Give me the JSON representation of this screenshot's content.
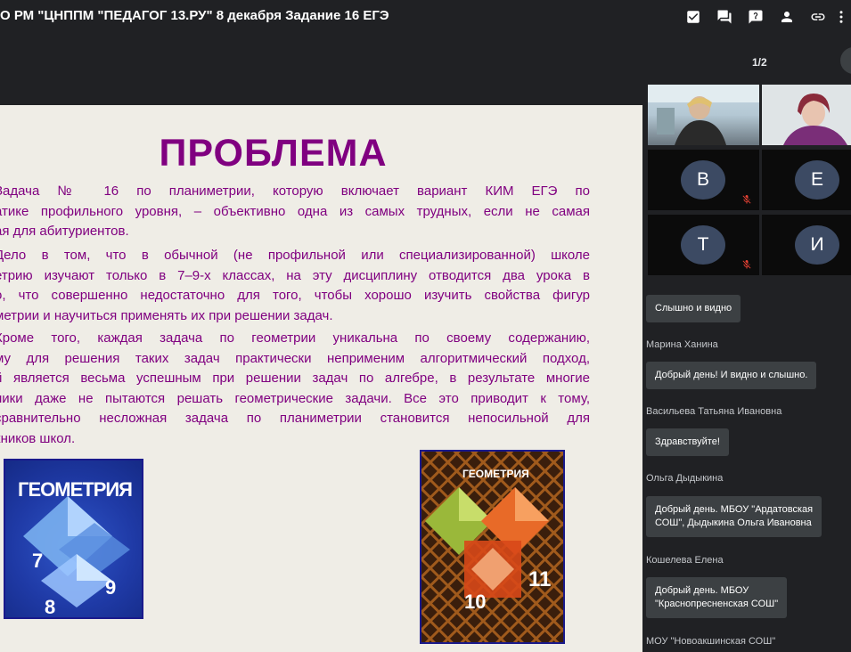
{
  "meeting": {
    "title": "О РМ \"ЦНППМ \"ПЕДАГОГ 13.РУ\"   8 декабря Задание 16 ЕГЭ"
  },
  "toolbar": {
    "icons": [
      "task-check-icon",
      "chat-icon",
      "help-icon",
      "person-icon",
      "link-icon",
      "more-icon"
    ]
  },
  "presentation": {
    "page_counter": "1/2"
  },
  "slide": {
    "title": "ПРОБЛЕМА",
    "para1_lines": [
      "         Задача  №  16  по  планиметрии,  которую  включает  вариант  КИМ  ЕГЭ  по",
      "атике  профильного  уровня,  –  объективно  одна  из  самых  трудных,  если  не  самая",
      "ая для абитуриентов."
    ],
    "para2_lines": [
      "         Дело в том, что в обычной (не профильной или специализированной) школе",
      "етрию изучают только в 7–9-х классах, на эту дисциплину отводится два урока в",
      "о, что совершенно недостаточно для того, чтобы хорошо изучить свойства фигур",
      "метрии и научиться применять их при решении задач."
    ],
    "para3_lines": [
      "         Кроме того, каждая задача по геометрии уникальна по своему содержанию,",
      "му  для  решения  таких  задач  практически  неприменим  алгоритмический  подход,",
      "й является весьма успешным при решении задач по алгебре, в результате многие",
      "ники даже не пытаются решать геометрические задачи. Все это приводит к тому,",
      "  сравнительно  несложная  задача  по  планиметрии  становится  непосильной  для",
      "кников школ."
    ],
    "book1": {
      "title": "ГЕОМЕТРИЯ",
      "numbers": [
        "7",
        "8",
        "9"
      ]
    },
    "book2": {
      "title": "ГЕОМЕТРИЯ",
      "numbers": [
        "10",
        "11"
      ]
    }
  },
  "participants": [
    {
      "type": "video"
    },
    {
      "type": "video"
    },
    {
      "type": "avatar",
      "initial": "В",
      "muted": true
    },
    {
      "type": "avatar",
      "initial": "Е",
      "muted": false
    },
    {
      "type": "avatar",
      "initial": "Т",
      "muted": true
    },
    {
      "type": "avatar",
      "initial": "И",
      "muted": false
    }
  ],
  "chat": {
    "messages": [
      {
        "sender": "",
        "text": "Слышно и видно"
      },
      {
        "sender": "Марина Ханина",
        "text": "Добрый день! И видно и слышно."
      },
      {
        "sender": "Васильева Татьяна Ивановна",
        "text": "Здравствуйте!"
      },
      {
        "sender": "Ольга Дыдыкина",
        "text_lines": [
          "Добрый день. МБОУ \"Ардатовская",
          "СОШ\", Дыдыкина Ольга Ивановна"
        ]
      },
      {
        "sender": "Кошелева Елена",
        "text_lines": [
          "Добрый день. МБОУ",
          "\"Краснопресненская СОШ\""
        ]
      },
      {
        "sender": "МОУ \"Новоакшинская СОШ\""
      }
    ]
  },
  "colors": {
    "background": "#202124",
    "slide_bg": "#efede6",
    "slide_text": "#800080",
    "bubble": "#3c4043",
    "avatar": "#3c4a63",
    "muted": "#ea4335"
  }
}
